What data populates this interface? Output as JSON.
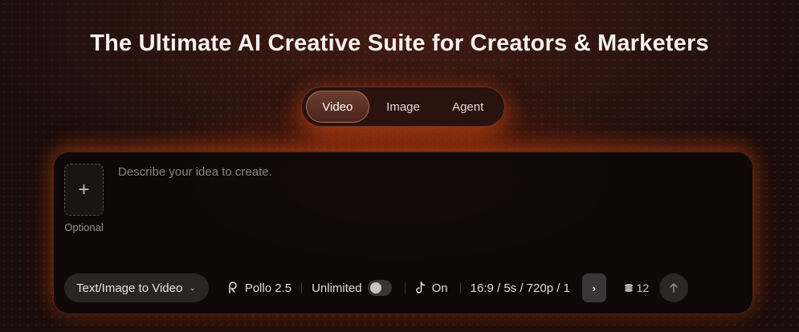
{
  "hero": {
    "title": "The Ultimate AI Creative Suite for Creators & Marketers"
  },
  "tabs": [
    {
      "label": "Video",
      "active": true
    },
    {
      "label": "Image",
      "active": false
    },
    {
      "label": "Agent",
      "active": false
    }
  ],
  "upload": {
    "icon": "plus-icon",
    "caption": "Optional"
  },
  "prompt": {
    "placeholder": "Describe your idea to create.",
    "value": ""
  },
  "toolbar": {
    "mode_label": "Text/Image to Video",
    "model_label": "Pollo 2.5",
    "unlimited_label": "Unlimited",
    "unlimited_on": false,
    "tiktok_label": "On",
    "settings_label": "16:9 / 5s / 720p / 1",
    "credits": "12"
  },
  "colors": {
    "accent_glow": "#ff5a14",
    "background": "#1a0e0c",
    "panel": "#100808"
  }
}
